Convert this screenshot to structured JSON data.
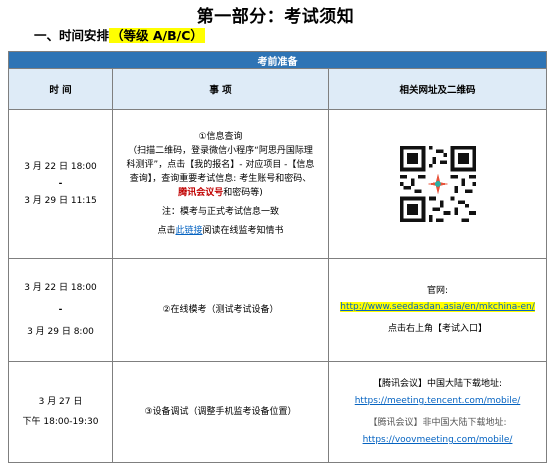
{
  "title": "第一部分：考试须知",
  "section": {
    "prefix": "一、时间安排",
    "level": "（等级 A/B/C）"
  },
  "table": {
    "banner": "考前准备",
    "headers": {
      "time": "时 间",
      "item": "事 项",
      "links": "相关网址及二维码"
    },
    "row1": {
      "time_start": "3 月 22 日 18:00",
      "time_sep": "-",
      "time_end": "3 月 29 日 11:15",
      "item_title": "①信息查询",
      "item_desc_1": "（扫描二维码，登录微信小程序“阿思丹国际理",
      "item_desc_2": "科测评”，点击【我的报名】- 对应项目 -【信息",
      "item_desc_3": "查询】，查询重要考试信息: 考生账号和密码、",
      "item_desc_4_red": "腾讯会议号",
      "item_desc_4_rest": "和密码等)",
      "item_note": "注：模考与正式考试信息一致",
      "item_link_pre": "点击",
      "item_link": "此链接",
      "item_link_post": "阅读在线监考知情书",
      "qr_icon": "qr-code"
    },
    "row2": {
      "time_start": "3 月 22 日 18:00",
      "time_sep": "-",
      "time_end": "3 月 29 日 8:00",
      "item": "②在线模考（测试考试设备）",
      "site_label": "官网:",
      "site_url": "http://www.seedasdan.asia/en/mkchina-en/",
      "site_hint": "点击右上角【考试入口】"
    },
    "row3": {
      "time_date": "3 月 27 日",
      "time_range": "下午 18:00-19:30",
      "item": "③设备调试（调整手机监考设备位置）",
      "cn_label": "【腾讯会议】中国大陆下载地址:",
      "cn_url": "https://meeting.tencent.com/mobile/",
      "intl_label": "【腾讯会议】非中国大陆下载地址:",
      "intl_url": "https://voovmeeting.com/mobile/"
    }
  },
  "colors": {
    "banner": "#2e74b5",
    "header_bg": "#deebf7",
    "highlight": "#ffff00",
    "link": "#0563c1",
    "red": "#c00000"
  }
}
